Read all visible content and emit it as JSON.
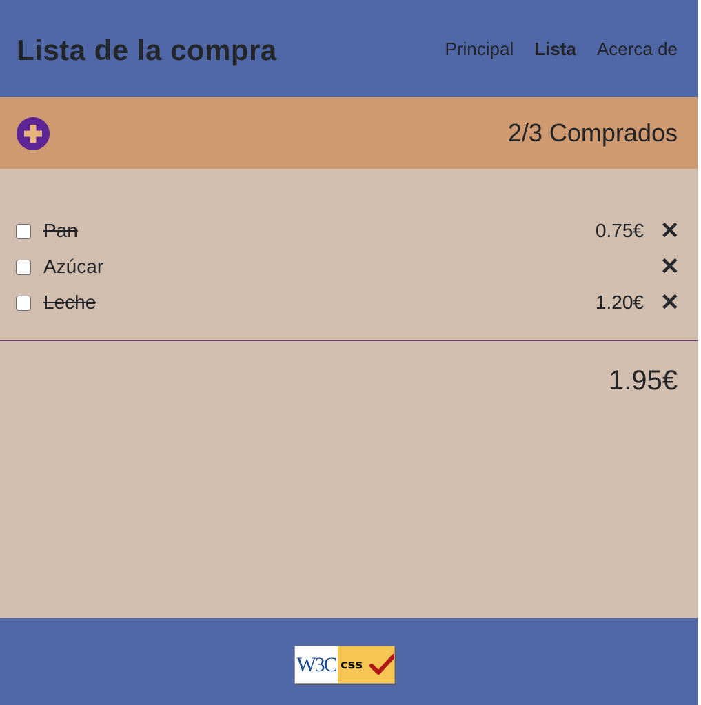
{
  "header": {
    "title": "Lista de la compra",
    "nav": [
      {
        "label": "Principal",
        "active": false
      },
      {
        "label": "Lista",
        "active": true
      },
      {
        "label": "Acerca de",
        "active": false
      }
    ]
  },
  "toolbar": {
    "add_icon": "plus-circle-icon",
    "summary": "2/3 Comprados"
  },
  "items": [
    {
      "name": "Pan",
      "price": "0.75€",
      "purchased": true,
      "checked": false
    },
    {
      "name": "Azúcar",
      "price": "",
      "purchased": false,
      "checked": false
    },
    {
      "name": "Leche",
      "price": "1.20€",
      "purchased": true,
      "checked": false
    }
  ],
  "total": "1.95€",
  "footer": {
    "badge_w3c": "W3C",
    "badge_css": "css"
  },
  "colors": {
    "header_bg": "#5068a8",
    "toolbar_bg": "#cf9a70",
    "main_bg": "#d2beae",
    "accent": "#5d2496"
  }
}
